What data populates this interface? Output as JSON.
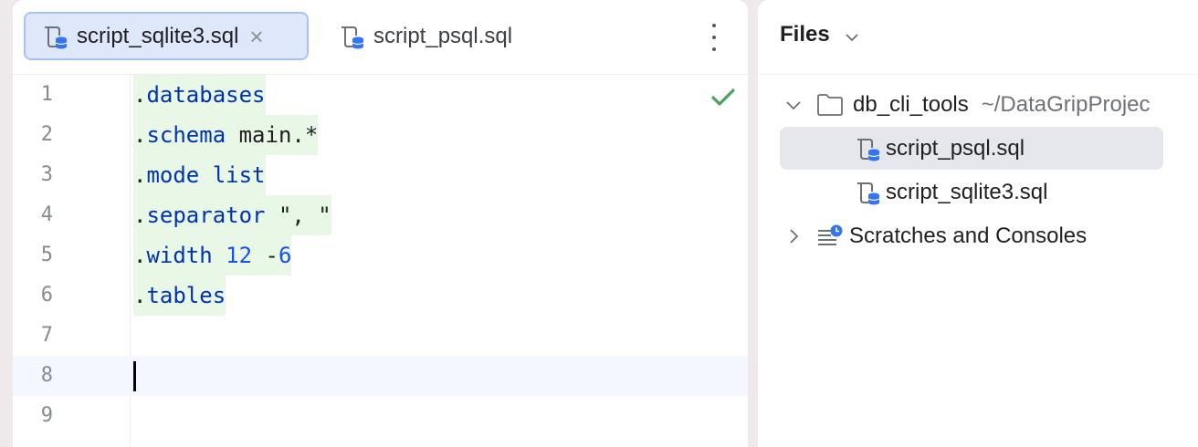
{
  "editor": {
    "tabs": [
      {
        "label": "script_sqlite3.sql",
        "active": true,
        "close": "×"
      },
      {
        "label": "script_psql.sql",
        "active": false
      }
    ],
    "lines": [
      {
        "number": "1",
        "tokens": [
          {
            "text": ".",
            "style": "plain"
          },
          {
            "text": "databases",
            "style": "kw"
          }
        ]
      },
      {
        "number": "2",
        "tokens": [
          {
            "text": ".",
            "style": "plain"
          },
          {
            "text": "schema",
            "style": "kw"
          },
          {
            "text": " main.*",
            "style": "plain"
          }
        ]
      },
      {
        "number": "3",
        "tokens": [
          {
            "text": ".",
            "style": "plain"
          },
          {
            "text": "mode",
            "style": "kw"
          },
          {
            "text": " ",
            "style": "plain"
          },
          {
            "text": "list",
            "style": "kw"
          }
        ]
      },
      {
        "number": "4",
        "tokens": [
          {
            "text": ".",
            "style": "plain"
          },
          {
            "text": "separator",
            "style": "kw"
          },
          {
            "text": " \", \"",
            "style": "plain"
          }
        ]
      },
      {
        "number": "5",
        "tokens": [
          {
            "text": ".",
            "style": "plain"
          },
          {
            "text": "width",
            "style": "kw"
          },
          {
            "text": " ",
            "style": "plain"
          },
          {
            "text": "12",
            "style": "num"
          },
          {
            "text": " -",
            "style": "plain"
          },
          {
            "text": "6",
            "style": "num"
          }
        ]
      },
      {
        "number": "6",
        "tokens": [
          {
            "text": ".",
            "style": "plain"
          },
          {
            "text": "tables",
            "style": "kw"
          }
        ]
      },
      {
        "number": "7",
        "tokens": []
      },
      {
        "number": "8",
        "tokens": []
      },
      {
        "number": "9",
        "tokens": []
      }
    ],
    "current_line": "8",
    "status_icon": "checkmark-icon"
  },
  "files": {
    "title": "Files",
    "project": {
      "name": "db_cli_tools",
      "path": "~/DataGripProjec"
    },
    "items": [
      {
        "label": "script_psql.sql",
        "selected": true
      },
      {
        "label": "script_sqlite3.sql",
        "selected": false
      }
    ],
    "scratches": "Scratches and Consoles"
  },
  "colors": {
    "keyword": "#0033b3",
    "number": "#1750eb",
    "changed_line": "#e8f7e6",
    "active_tab": "#dfe8fb",
    "check": "#49a35f"
  }
}
